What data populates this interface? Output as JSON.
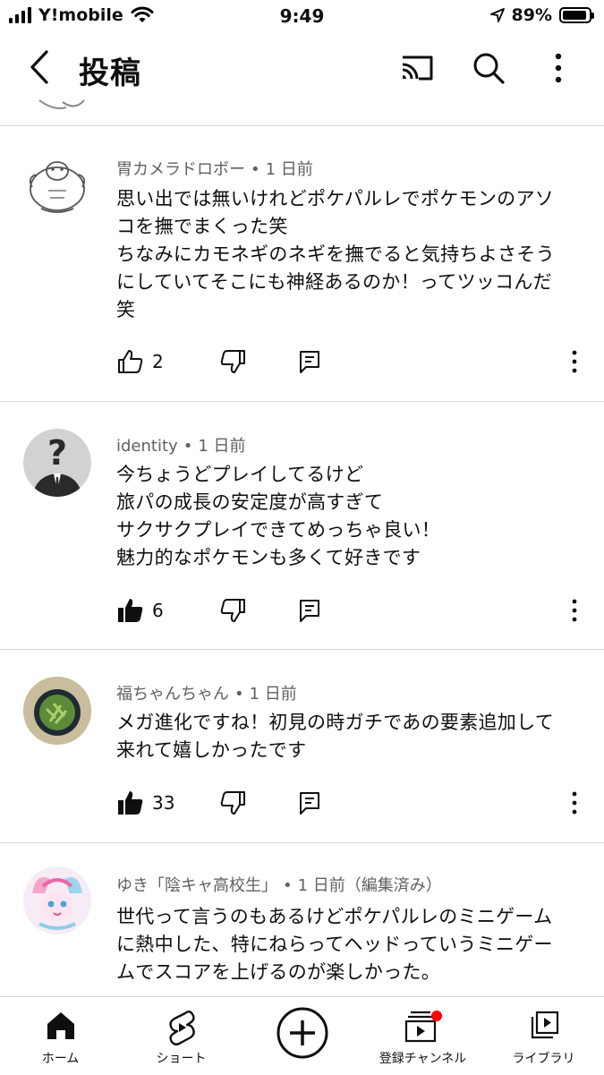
{
  "status_bar": {
    "carrier": "Y!mobile",
    "time": "9:49",
    "battery": "89%"
  },
  "header": {
    "title": "投稿"
  },
  "comments": [
    {
      "author": "胃カメラドロボー",
      "time": "1 日前",
      "lines": [
        "思い出では無いけれどポケパルレでポケモンのアソ",
        "コを撫でまくった笑",
        "ちなみにカモネギのネギを撫でると気持ちよさそう",
        "にしていてそこにも神経あるのか！ってツッコんだ",
        "笑"
      ],
      "likes": "2",
      "liked": false
    },
    {
      "author": "identity",
      "time": "1 日前",
      "lines": [
        "今ちょうどプレイしてるけど",
        "旅パの成長の安定度が高すぎて",
        "サクサクプレイできてめっちゃ良い！",
        "魅力的なポケモンも多くて好きです"
      ],
      "likes": "6",
      "liked": true
    },
    {
      "author": "福ちゃんちゃん",
      "time": "1 日前",
      "lines": [
        "メガ進化ですね！初見の時ガチであの要素追加して",
        "来れて嬉しかったです"
      ],
      "likes": "33",
      "liked": true
    },
    {
      "author": "ゆき「陰キャ高校生」",
      "time": "1 日前（編集済み）",
      "lines": [
        "世代って言うのもあるけどポケパルレのミニゲーム",
        "に熱中した、特にねらってヘッドっていうミニゲー",
        "ムでスコアを上げるのが楽しかった。"
      ],
      "likes": "",
      "liked": false
    }
  ],
  "bottom_nav": {
    "home": "ホーム",
    "shorts": "ショート",
    "subscriptions": "登録チャンネル",
    "library": "ライブラリ"
  },
  "colors": {
    "accent_red": "#ff0000",
    "text": "#0f0f0f",
    "meta": "#606060"
  }
}
